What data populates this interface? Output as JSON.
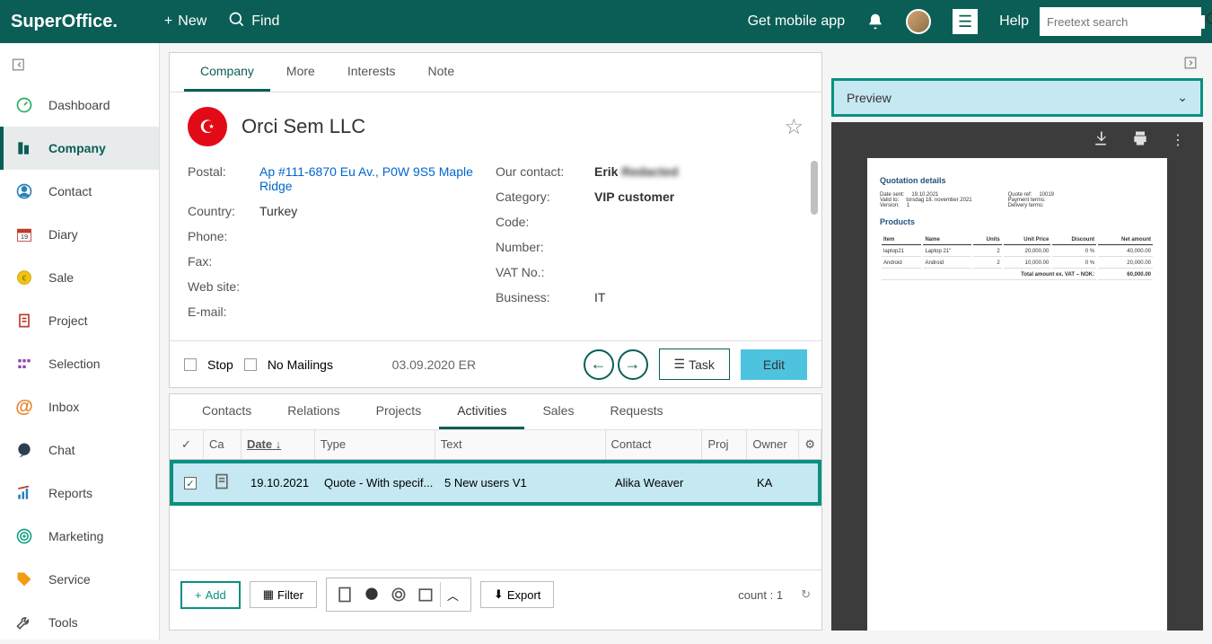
{
  "header": {
    "logo": "SuperOffice.",
    "new_label": "New",
    "find_label": "Find",
    "mobile_app": "Get mobile app",
    "help_label": "Help",
    "search_placeholder": "Freetext search"
  },
  "sidebar": {
    "items": [
      {
        "label": "Dashboard"
      },
      {
        "label": "Company"
      },
      {
        "label": "Contact"
      },
      {
        "label": "Diary"
      },
      {
        "label": "Sale"
      },
      {
        "label": "Project"
      },
      {
        "label": "Selection"
      },
      {
        "label": "Inbox"
      },
      {
        "label": "Chat"
      },
      {
        "label": "Reports"
      },
      {
        "label": "Marketing"
      },
      {
        "label": "Service"
      },
      {
        "label": "Tools"
      }
    ]
  },
  "tabs": {
    "main": [
      "Company",
      "More",
      "Interests",
      "Note"
    ],
    "sub": [
      "Contacts",
      "Relations",
      "Projects",
      "Activities",
      "Sales",
      "Requests"
    ]
  },
  "company": {
    "name": "Orci Sem LLC",
    "fields_left": {
      "postal_label": "Postal:",
      "postal_value": "Ap #111-6870 Eu Av., P0W 9S5 Maple Ridge",
      "country_label": "Country:",
      "country_value": "Turkey",
      "phone_label": "Phone:",
      "fax_label": "Fax:",
      "website_label": "Web site:",
      "email_label": "E-mail:"
    },
    "fields_right": {
      "our_contact_label": "Our contact:",
      "our_contact_value": "Erik",
      "category_label": "Category:",
      "category_value": "VIP customer",
      "code_label": "Code:",
      "number_label": "Number:",
      "vat_label": "VAT No.:",
      "business_label": "Business:",
      "business_value": "IT"
    },
    "footer": {
      "stop_label": "Stop",
      "no_mailings_label": "No Mailings",
      "timestamp": "03.09.2020 ER",
      "task_label": "Task",
      "edit_label": "Edit"
    }
  },
  "grid": {
    "columns": {
      "check": "✓",
      "cat": "Ca",
      "date": "Date",
      "type": "Type",
      "text": "Text",
      "contact": "Contact",
      "proj": "Proj",
      "owner": "Owner"
    },
    "row": {
      "date": "19.10.2021",
      "type": "Quote - With specif...",
      "text": "5 New users V1",
      "contact": "Alika Weaver",
      "owner": "KA"
    },
    "footer": {
      "add": "Add",
      "filter": "Filter",
      "export": "Export",
      "count": "count : 1"
    }
  },
  "preview": {
    "label": "Preview",
    "doc": {
      "title": "Quotation details",
      "meta_left": [
        {
          "k": "Date sent:",
          "v": "19.10.2021"
        },
        {
          "k": "Valid to:",
          "v": "torsdag 18. november 2021"
        },
        {
          "k": "Version:",
          "v": "1"
        }
      ],
      "meta_right": [
        {
          "k": "Quote ref:",
          "v": "10019"
        },
        {
          "k": "Payment terms:",
          "v": ""
        },
        {
          "k": "Delivery terms:",
          "v": ""
        }
      ],
      "products_title": "Products",
      "cols": [
        "Item",
        "Name",
        "Units",
        "Unit Price",
        "Discount",
        "Net amount"
      ],
      "rows": [
        [
          "laptop21",
          "Laptop 21\"",
          "2",
          "20,000.00",
          "0 %",
          "40,000.00"
        ],
        [
          "Android",
          "Android",
          "2",
          "10,000.00",
          "0 %",
          "20,000.00"
        ]
      ],
      "total_label": "Total amount ex. VAT – NOK:",
      "total_value": "60,000.00"
    }
  }
}
